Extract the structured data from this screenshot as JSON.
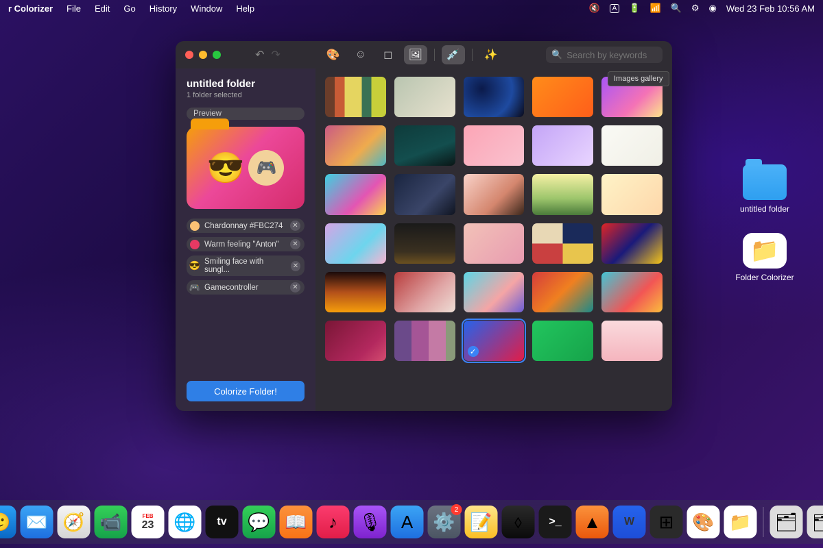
{
  "menubar": {
    "app": "r Colorizer",
    "items": [
      "File",
      "Edit",
      "Go",
      "History",
      "Window",
      "Help"
    ],
    "datetime": "Wed 23 Feb  10:56 AM"
  },
  "desktop": {
    "folder_label": "untitled folder",
    "app_label": "Folder Colorizer"
  },
  "window": {
    "title": "untitled folder",
    "subtitle": "1 folder selected",
    "preview_label": "Preview",
    "tooltip": "Images gallery",
    "search_placeholder": "Search by keywords",
    "colorize_cta": "Colorize Folder!",
    "tags": [
      {
        "label": "Chardonnay #FBC274",
        "color": "#FBC274",
        "kind": "color"
      },
      {
        "label": "Warm feeling \"Anton\"",
        "color": "#e63963",
        "kind": "theme"
      },
      {
        "label": "Smiling face with sungl...",
        "emoji": "😎",
        "kind": "emoji"
      },
      {
        "label": "Gamecontroller",
        "emoji": "🎮",
        "kind": "symbol"
      }
    ],
    "tabs": [
      {
        "name": "palette",
        "active": false
      },
      {
        "name": "emoji",
        "active": false
      },
      {
        "name": "symbol",
        "active": false
      },
      {
        "name": "images",
        "active": true
      },
      {
        "name": "eyedropper",
        "active": false
      },
      {
        "name": "magic",
        "active": false
      }
    ],
    "gallery": [
      {
        "bg": "linear-gradient(90deg,#6b3d2a 0%,#6b3d2a 16%,#c95b36 16%,#c95b36 32%,#e5d560 32%,#e5d560 60%,#3a7254 60%,#3a7254 76%,#c7cf3a 76%)"
      },
      {
        "bg": "linear-gradient(135deg,#b9c5b0 0%,#e8e2cf 100%)"
      },
      {
        "bg": "radial-gradient(circle at 30% 30%,#0b1a4a,#1e4aa0 60%,#0a0a1a)"
      },
      {
        "bg": "linear-gradient(135deg,#ff8c1a,#ff5e1a)"
      },
      {
        "bg": "linear-gradient(135deg,#a855f7,#f472b6 60%,#fde68a)"
      },
      {
        "bg": "linear-gradient(135deg,#ca5b83,#efab4d 60%,#4fb6c2)"
      },
      {
        "bg": "linear-gradient(160deg,#0e3b3b,#134e4e 60%,#0a1616)"
      },
      {
        "bg": "linear-gradient(135deg,#fca5b6,#f9c2cf)"
      },
      {
        "bg": "linear-gradient(135deg,#c4a5f7,#e9d5ff)"
      },
      {
        "bg": "linear-gradient(135deg,#fafaf5,#f0efe6)"
      },
      {
        "bg": "linear-gradient(135deg,#3dd0e0,#e355b3 60%,#fcd34d)"
      },
      {
        "bg": "linear-gradient(135deg,#1a2540,#3a4568 60%,#0f1420)"
      },
      {
        "bg": "linear-gradient(135deg,#f9d2c9,#d4866e 60%,#3a261a)"
      },
      {
        "bg": "linear-gradient(180deg,#f5f0a5,#9cc56b 60%,#4a7a3a)"
      },
      {
        "bg": "linear-gradient(135deg,#fef3c7,#fed7aa)"
      },
      {
        "bg": "linear-gradient(135deg,#d4a5e5,#6dd5ed 60%,#f7b4d2)"
      },
      {
        "bg": "linear-gradient(180deg,#1a1a1a,#3a3020 70%,#6b5020)"
      },
      {
        "bg": "linear-gradient(135deg,#f2c2b8,#e89bb0)"
      },
      {
        "bg": "conic-gradient(#1a2a5a 0 90deg,#e8c54d 90deg 180deg,#c94040 180deg 270deg,#e8d8b5 270deg)"
      },
      {
        "bg": "linear-gradient(135deg,#e02525,#1a1a7a 50%,#f5c518)"
      },
      {
        "bg": "linear-gradient(180deg,#1a0a0a,#b3501a 50%,#f59e0b)"
      },
      {
        "bg": "linear-gradient(135deg,#b83d3d,#e0a5a5 60%,#eeddd5)"
      },
      {
        "bg": "linear-gradient(135deg,#5dd5e5,#f5a5a5 60%,#6b5dd5)"
      },
      {
        "bg": "linear-gradient(135deg,#d43c3c,#f08020 50%,#1a8a8a)"
      },
      {
        "bg": "linear-gradient(135deg,#41c5d5,#f25555 60%,#fabd3d)"
      },
      {
        "bg": "linear-gradient(135deg,#7a1636,#b3285e 70%,#d44d70)"
      },
      {
        "bg": "repeating-linear-gradient(90deg,#6b4a8a 0 25px,#a55596 25px 50px,#c47aa5 50px 75px,#8a9a7a 75px 100px)"
      },
      {
        "bg": "linear-gradient(135deg,#2563eb,#e11d48)",
        "selected": true
      },
      {
        "bg": "linear-gradient(135deg,#22c55e,#16a34a)"
      },
      {
        "bg": "linear-gradient(180deg,#fadadd,#f5b5be)"
      }
    ]
  },
  "dock": {
    "items": [
      {
        "name": "launchpad",
        "bg": "linear-gradient(#e5e5e5,#c5c5c5)",
        "glyph": "▦"
      },
      {
        "name": "finder",
        "bg": "linear-gradient(#2aa0f5,#0a68c5)",
        "glyph": "🙂"
      },
      {
        "name": "mail",
        "bg": "linear-gradient(#3ba5f5,#1e6fe0)",
        "glyph": "✉️"
      },
      {
        "name": "safari",
        "bg": "linear-gradient(#f5f5f5,#d5d5d5)",
        "glyph": "🧭"
      },
      {
        "name": "facetime",
        "bg": "linear-gradient(#34d058,#16a34a)",
        "glyph": "📹"
      },
      {
        "name": "calendar",
        "bg": "#fff",
        "glyph": "23",
        "text": true,
        "top": "FEB"
      },
      {
        "name": "chrome",
        "bg": "#fff",
        "glyph": "🌐"
      },
      {
        "name": "appletv",
        "bg": "#111",
        "glyph": "tv",
        "text": true
      },
      {
        "name": "messages",
        "bg": "linear-gradient(#34d058,#16a34a)",
        "glyph": "💬"
      },
      {
        "name": "books",
        "bg": "linear-gradient(#fb923c,#f97316)",
        "glyph": "📖"
      },
      {
        "name": "music",
        "bg": "linear-gradient(#fb3c6e,#e11d48)",
        "glyph": "♪"
      },
      {
        "name": "podcasts",
        "bg": "linear-gradient(#a855f7,#7e22ce)",
        "glyph": "🎙"
      },
      {
        "name": "appstore",
        "bg": "linear-gradient(#3ba5f5,#1e6fe0)",
        "glyph": "A"
      },
      {
        "name": "settings",
        "bg": "linear-gradient(#6b7280,#4b5563)",
        "glyph": "⚙️",
        "badge": "2"
      },
      {
        "name": "notes",
        "bg": "linear-gradient(#fde68a,#fbbf24)",
        "glyph": "📝"
      },
      {
        "name": "game",
        "bg": "linear-gradient(#2a2a2a,#0a0a0a)",
        "glyph": "⬨"
      },
      {
        "name": "terminal",
        "bg": "#1a1a1a",
        "glyph": ">_",
        "text": true
      },
      {
        "name": "vlc",
        "bg": "linear-gradient(#fb923c,#ea580c)",
        "glyph": "▲"
      },
      {
        "name": "word",
        "bg": "linear-gradient(#2563eb,#1d4ed8)",
        "glyph": "W",
        "text": true
      },
      {
        "name": "calculator",
        "bg": "#2a2a2a",
        "glyph": "⊞"
      },
      {
        "name": "colorsync",
        "bg": "#fff",
        "glyph": "🎨"
      },
      {
        "name": "colorizer-app",
        "bg": "#fff",
        "glyph": "📁"
      }
    ]
  }
}
